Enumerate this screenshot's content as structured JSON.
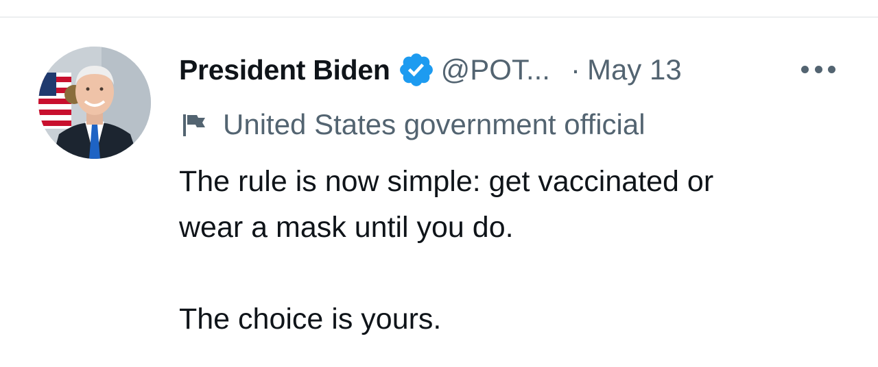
{
  "tweet": {
    "author": {
      "name": "President Biden",
      "handle": "@POT...",
      "verified": true,
      "verified_color": "#1d9bf0"
    },
    "separator": "·",
    "date": "May 13",
    "label": {
      "icon": "flag-icon",
      "text": "United States government official"
    },
    "text": {
      "line1": "The rule is now simple: get vaccinated or",
      "line2": "wear a mask until you do.",
      "line3": "The choice is yours."
    },
    "menu_icon": "more-icon"
  }
}
